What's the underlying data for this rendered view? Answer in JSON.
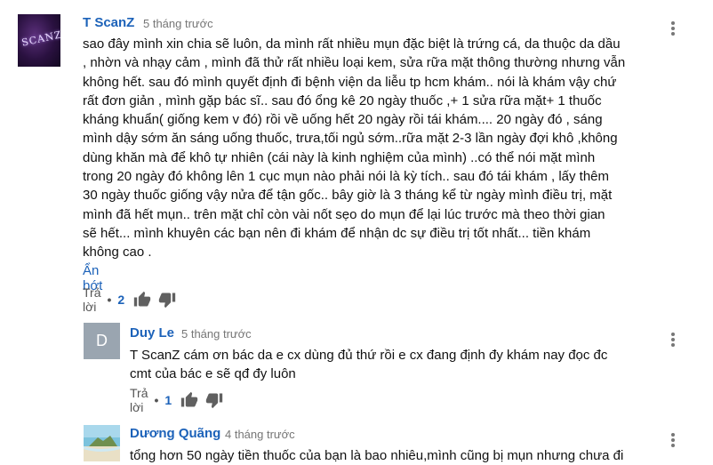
{
  "comments": [
    {
      "author": "T ScanZ",
      "time": "5 tháng trước",
      "avatar_text": "SCANZ",
      "body": "sao đây mình xin chia sẽ luôn, da mình rất nhiều mụn đặc biệt là trứng cá, da thuộc da dầu\n, nhờn và nhạy cảm , mình đã thử rất nhiều loại kem, sửa rữa mặt thông thường nhưng vẫn\nkhông hết. sau đó mình quyết định đi bệnh viện da liễu tp hcm khám..  nói là khám vậy chứ\nrất đơn giản , mình gặp bác sĩ.. sau đó ổng kê 20 ngày thuốc ,+ 1 sửa rữa mặt+ 1 thuốc\nkháng khuẩn( giống kem v đó) rồi về uống hết 20 ngày rồi tái khám.... 20 ngày đó , sáng\nmình dậy sớm ăn sáng uống thuốc, trưa,tối ngủ sớm..rữa mặt 2-3 lần ngày đợi khô ,không\ndùng khăn mà để khô tự nhiên (cái này là kinh nghiệm của mình) ..có thể nói mặt mình\ntrong 20 ngày đó không lên 1 cục mụn nào phải nói là kỳ tích.. sau đó tái khám , lấy thêm\n30 ngày thuốc giống vậy nửa để tận gốc.. bây giờ là 3 tháng kể từ ngày mình điều trị, mặt\nmình đã hết mụn.. trên mặt chỉ còn vài nốt sẹo do mụn để lại lúc trước mà theo thời gian\nsẽ hết... mình khuyên các bạn nên đi khám để nhận dc sự điều trị tốt nhất... tiền khám\nkhông cao .",
      "show_less": "Ẩn bớt",
      "reply_label": "Trả lời",
      "like_count": "2"
    },
    {
      "author": "Duy Le",
      "time": "5 tháng trước",
      "avatar_letter": "D",
      "body": "T ScanZ cám ơn bác da e cx dùng đủ thứ rồi e cx đang định đy khám nay đọc đc\ncmt của bác e sẽ qđ đy  luôn",
      "reply_label": "Trả lời",
      "like_count": "1"
    },
    {
      "author": "Dương Quãng",
      "time": "4 tháng trước",
      "body": "tổng hơn 50 ngày tiền thuốc của bạn là bao nhiêu,mình cũng bị mụn nhưng chưa đi"
    }
  ],
  "icons": {
    "menu": "more-vert-icon",
    "like": "thumb-up-icon",
    "dislike": "thumb-down-icon"
  },
  "colors": {
    "author": "#1c62b9",
    "meta": "#767676",
    "icon": "#555555"
  }
}
